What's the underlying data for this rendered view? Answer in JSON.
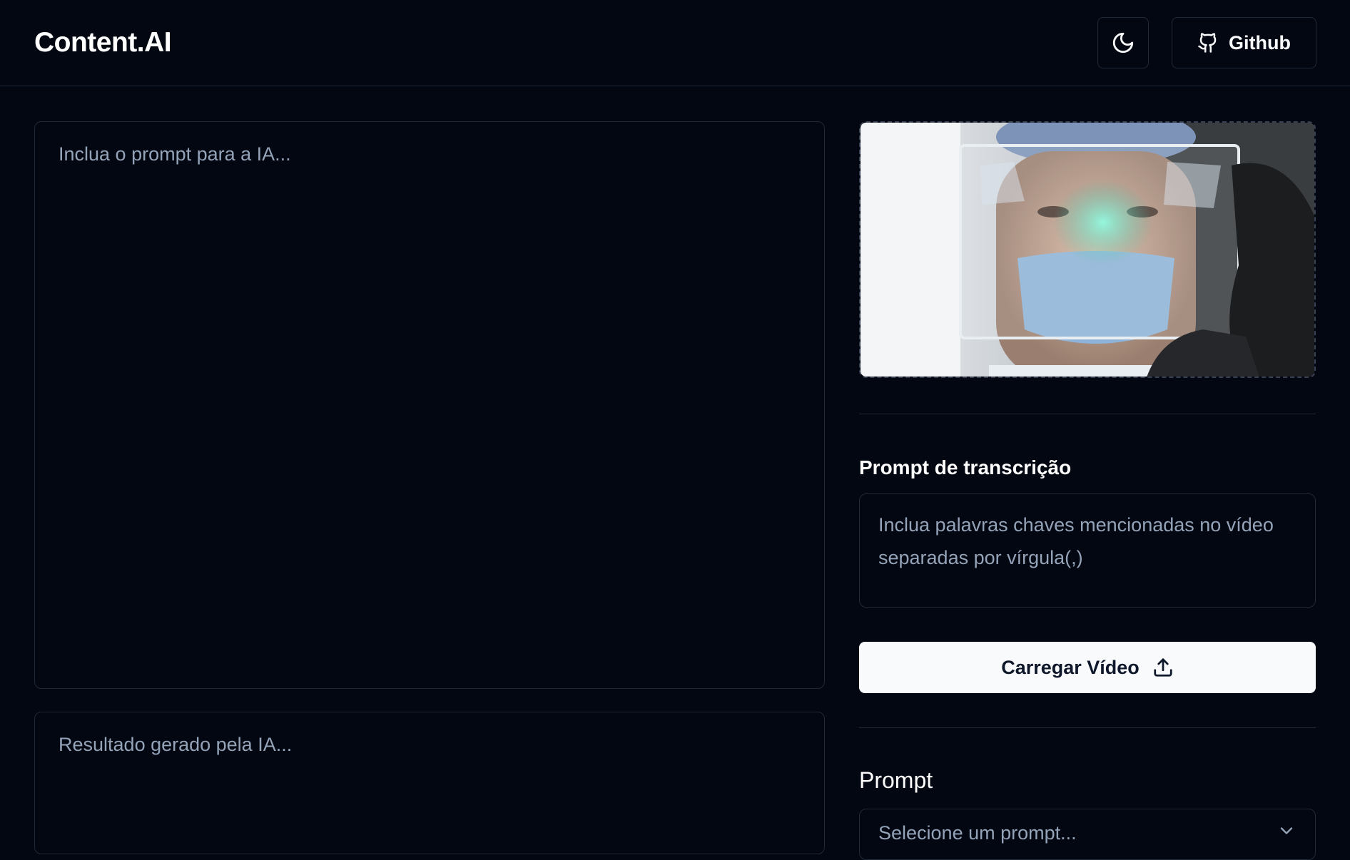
{
  "header": {
    "logo": "Content.AI",
    "github_label": "Github",
    "theme_icon": "moon-icon",
    "github_icon": "github-icon"
  },
  "main": {
    "prompt_placeholder": "Inclua o prompt para a IA...",
    "result_placeholder": "Resultado gerado pela IA..."
  },
  "sidebar": {
    "transcription_label": "Prompt de transcrição",
    "transcription_placeholder": "Inclua palavras chaves mencionadas no vídeo separadas por vírgula(,)",
    "upload_label": "Carregar Vídeo",
    "upload_icon": "upload-icon",
    "prompt_label": "Prompt",
    "prompt_select_value": "Selecione um prompt..."
  },
  "colors": {
    "background": "#030712",
    "border": "#1f2937",
    "placeholder": "#94a3b8",
    "button_bg": "#f8fafc"
  }
}
